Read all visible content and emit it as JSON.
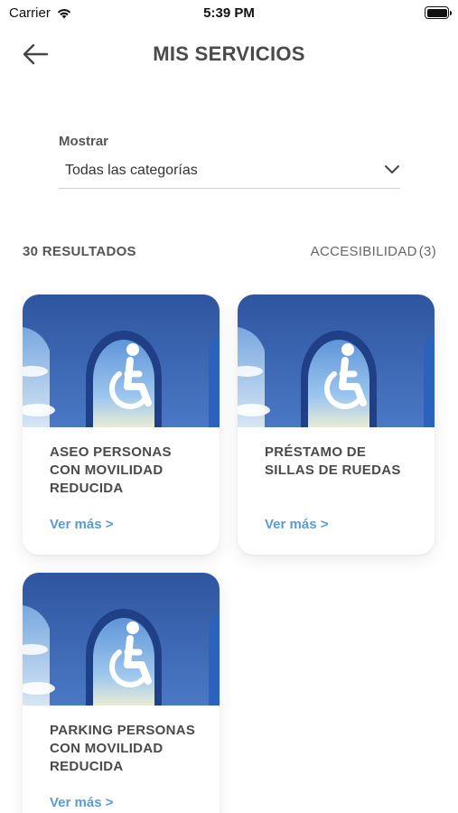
{
  "status_bar": {
    "carrier": "Carrier",
    "time": "5:39 PM"
  },
  "header": {
    "title": "MIS SERVICIOS",
    "back_icon": "arrow-left-icon"
  },
  "filter": {
    "label": "Mostrar",
    "selected": "Todas las categorías"
  },
  "results": {
    "count_label": "30 RESULTADOS",
    "category": "ACCESIBILIDAD",
    "category_count": "(3)"
  },
  "services": [
    {
      "title": "ASEO PERSONAS CON MOVILIDAD REDUCIDA",
      "link": "Ver más >",
      "icon": "wheelchair-icon"
    },
    {
      "title": "PRÉSTAMO DE SILLAS DE RUEDAS",
      "link": "Ver más >",
      "icon": "wheelchair-icon"
    },
    {
      "title": "PARKING PERSONAS CON MOVILIDAD REDUCIDA",
      "link": "Ver más >",
      "icon": "wheelchair-icon"
    }
  ],
  "colors": {
    "accent": "#5b9bd1",
    "title": "#4a4a4a",
    "image_blue": "#3d63a8"
  }
}
